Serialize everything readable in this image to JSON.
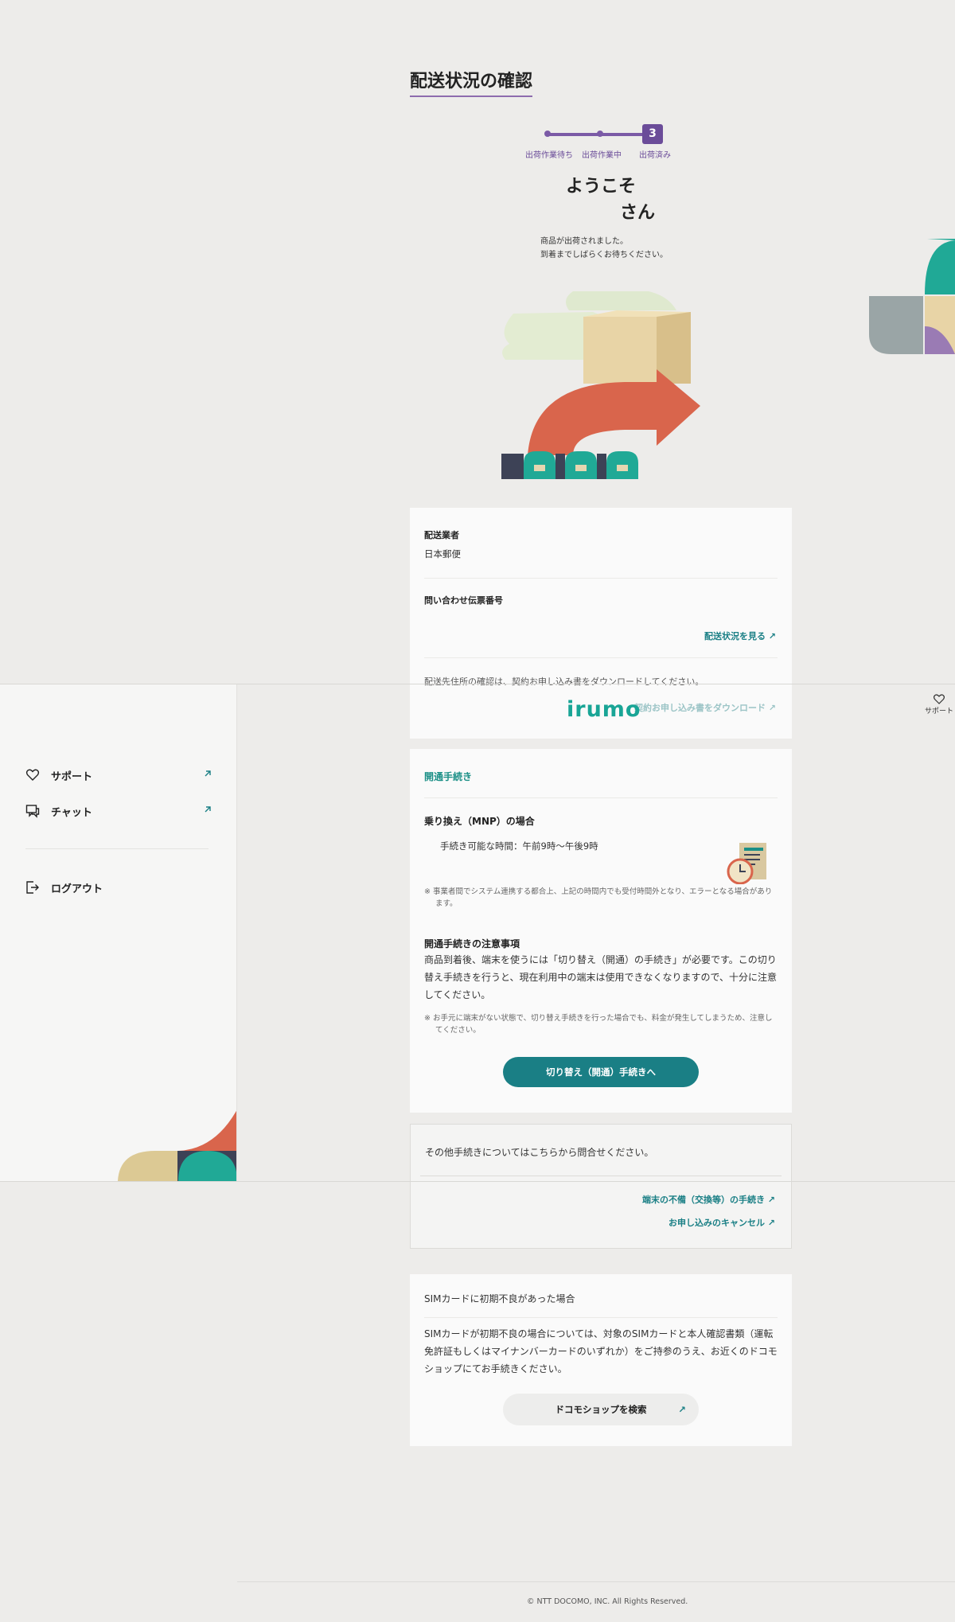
{
  "header": {
    "logo_text": "irumo",
    "overlay_download_text": "契約お申し込み書をダウンロード",
    "support_label": "サポート"
  },
  "sidebar": {
    "items": [
      {
        "label": "サポート",
        "icon": "heart-icon",
        "external": true
      },
      {
        "label": "チャット",
        "icon": "chat-icon",
        "external": true
      },
      {
        "label": "ログアウト",
        "icon": "logout-icon",
        "external": false
      }
    ]
  },
  "page": {
    "title": "配送状況の確認",
    "steps": [
      {
        "label": "出荷作業待ち"
      },
      {
        "label": "出荷作業中"
      },
      {
        "label": "出荷済み",
        "number": "3",
        "current": true
      }
    ],
    "welcome": "ようこそ",
    "honorific": "さん",
    "message_lines": [
      "商品が出荷されました。",
      "到着までしばらくお待ちください。"
    ]
  },
  "shipping": {
    "carrier_label": "配送業者",
    "carrier_value": "日本郵便",
    "tracking_label": "問い合わせ伝票番号",
    "tracking_link": "配送状況を見る",
    "address_note": "配送先住所の確認は、契約お申し込み書をダウンロードしてください。",
    "download_link": "契約お申し込み書をダウンロード"
  },
  "activation": {
    "section_title": "開通手続き",
    "mnp_heading": "乗り換え（MNP）の場合",
    "hours": "手続き可能な時間：午前9時〜午後9時",
    "hours_note": "※ 事業者間でシステム連携する都合上、上記の時間内でも受付時間外となり、エラーとなる場合があります。",
    "caution_heading": "開通手続きの注意事項",
    "caution_body": "商品到着後、端末を使うには「切り替え（開通）の手続き」が必要です。この切り替え手続きを行うと、現在利用中の端末は使用できなくなりますので、十分に注意してください。",
    "caution_note": "※ お手元に端末がない状態で、切り替え手続きを行った場合でも、料金が発生してしまうため、注意してください。",
    "button": "切り替え（開通）手続きへ"
  },
  "other": {
    "intro": "その他手続きについてはこちらから問合せください。",
    "links": [
      "端末の不備（交換等）の手続き",
      "お申し込みのキャンセル"
    ]
  },
  "sim": {
    "heading": "SIMカードに初期不良があった場合",
    "body": "SIMカードが初期不良の場合については、対象のSIMカードと本人確認書類（運転免許証もしくはマイナンバーカードのいずれか）をご持参のうえ、お近くのドコモショップにてお手続きください。",
    "button": "ドコモショップを検索"
  },
  "footer": {
    "copyright": "© NTT DOCOMO, INC. All Rights Reserved."
  },
  "colors": {
    "background": "#edecea",
    "accent_purple": "#6b4c99",
    "accent_teal": "#1a7f85",
    "logo_teal": "#19a596"
  }
}
